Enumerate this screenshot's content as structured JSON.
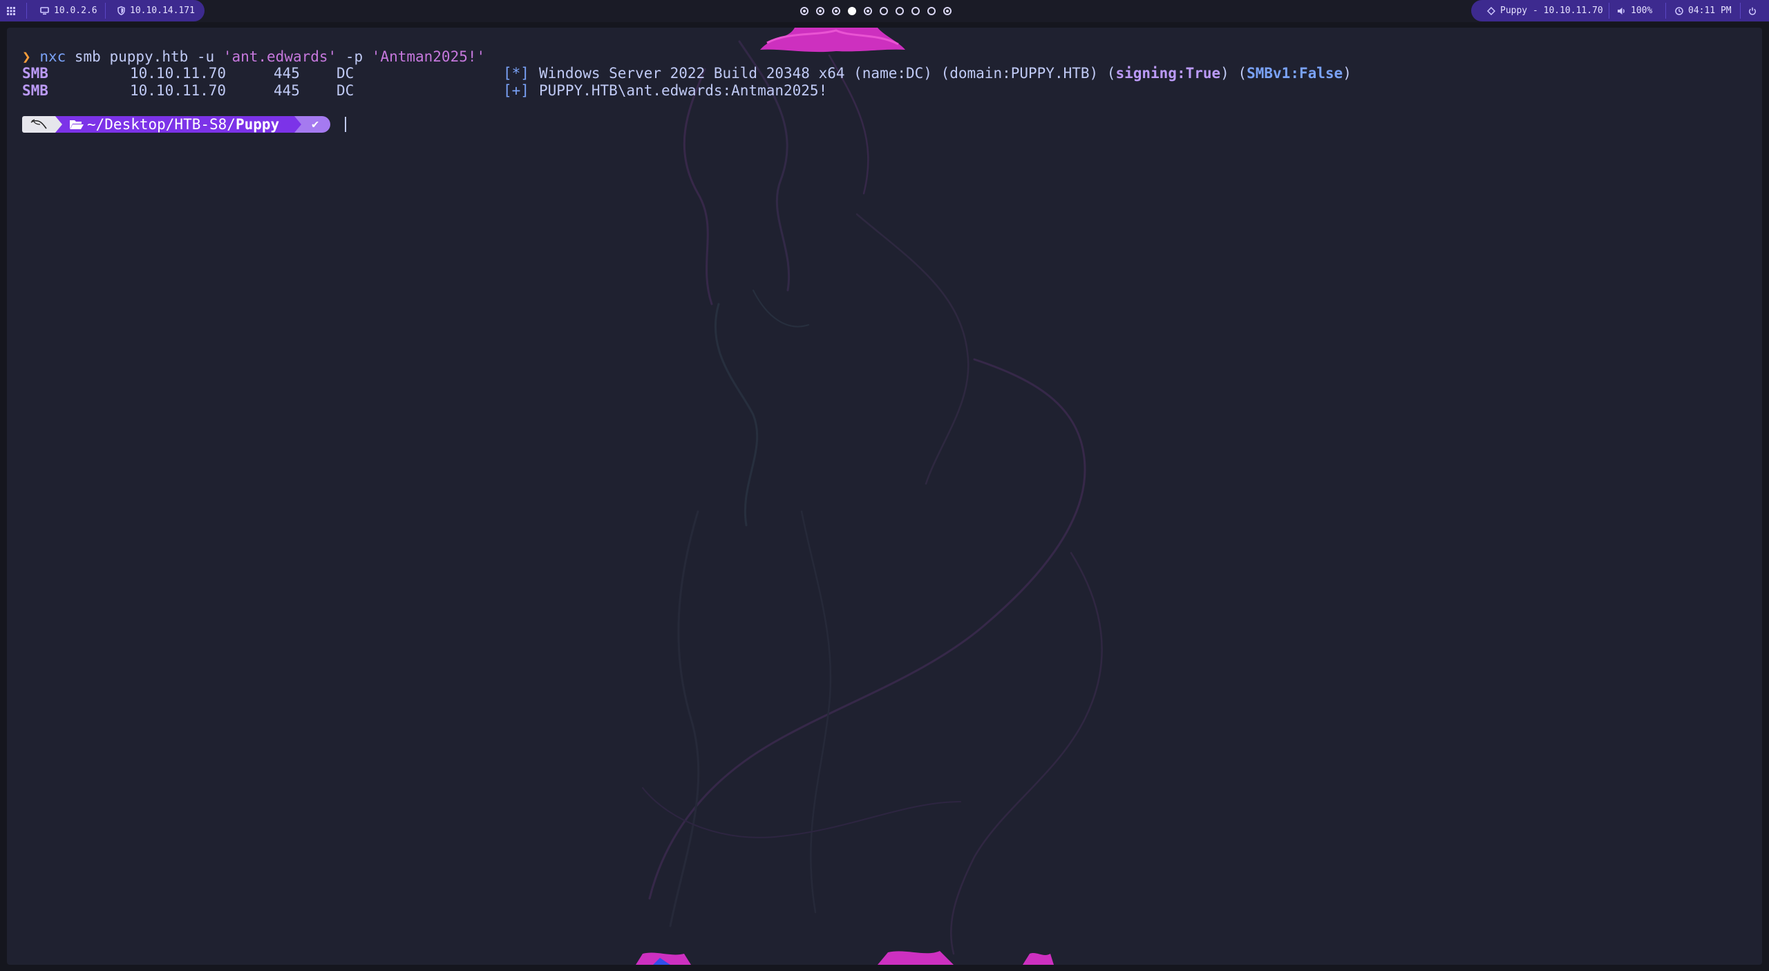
{
  "topbar": {
    "apps_icon": "grid-icon",
    "eth_ip": "10.0.2.6",
    "vpn_ip": "10.10.14.171",
    "workspaces": [
      "occupied",
      "occupied",
      "occupied",
      "active",
      "occupied",
      "empty",
      "empty",
      "empty",
      "empty",
      "occupied"
    ],
    "target": "Puppy - 10.10.11.70",
    "volume": "100%",
    "clock": "04:11 PM",
    "power_icon": "power-icon"
  },
  "terminal": {
    "line1": {
      "prompt": "❯",
      "cmd": "nxc",
      "args1": " smb puppy.htb -u ",
      "user": "'ant.edwards'",
      "args2": " -p ",
      "pass": "'Antman2025!'"
    },
    "rows": [
      {
        "proto": "SMB",
        "ip": "10.10.11.70",
        "port": "445",
        "host": "DC",
        "tag": "[*]",
        "msg": "Windows Server 2022 Build 20348 x64 (name:DC) (domain:PUPPY.HTB) (",
        "signing": "signing:True",
        "mid": ") (",
        "smbv1": "SMBv1:False",
        "end": ")"
      },
      {
        "proto": "SMB",
        "ip": "10.10.11.70",
        "port": "445",
        "host": "DC",
        "tag": "[+]",
        "msg": "PUPPY.HTB\\ant.edwards:Antman2025!"
      }
    ],
    "prompt2": {
      "os_icon": "kali-dragon-icon",
      "folder_icon": "folder-open-icon",
      "path": "~/Desktop/HTB-S8/",
      "path_last": "Puppy",
      "status": "✔"
    }
  }
}
